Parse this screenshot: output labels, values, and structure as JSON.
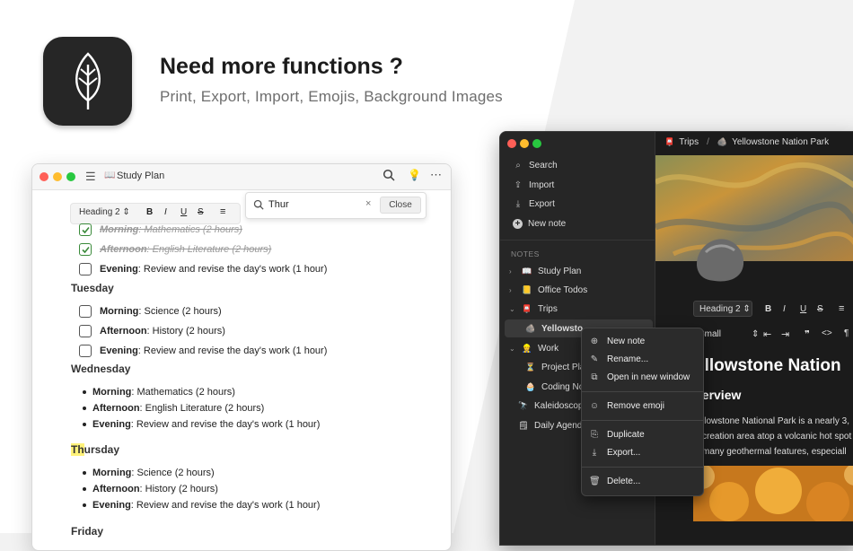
{
  "promo": {
    "headline": "Need more functions ?",
    "subline": "Print, Export, Import, Emojis, Background Images"
  },
  "light_window": {
    "title": "Study Plan",
    "format_bar": {
      "style": "Heading 2",
      "bold": "B",
      "italic": "I",
      "underline": "U",
      "strike": "S"
    },
    "search": {
      "value": "Thur",
      "close_label": "Close"
    },
    "tasks_top": [
      {
        "label": "Morning",
        "text": ": Mathematics (2 hours)",
        "done": true
      },
      {
        "label": "Afternoon",
        "text": ": English Literature (2 hours)",
        "done": true
      },
      {
        "label": "Evening",
        "text": ": Review and revise the day's work (1 hour)",
        "done": false
      }
    ],
    "tuesday": {
      "heading": "Tuesday",
      "tasks": [
        {
          "label": "Morning",
          "text": ": Science (2 hours)"
        },
        {
          "label": "Afternoon",
          "text": ": History (2 hours)"
        },
        {
          "label": "Evening",
          "text": ": Review and revise the day's work (1 hour)"
        }
      ]
    },
    "wednesday": {
      "heading": "Wednesday",
      "items": [
        {
          "label": "Morning",
          "text": ": Mathematics (2 hours)"
        },
        {
          "label": "Afternoon",
          "text": ": English Literature (2 hours)"
        },
        {
          "label": "Evening",
          "text": ": Review and revise the day's work (1 hour)"
        }
      ]
    },
    "thursday": {
      "heading_highlight": "Th",
      "heading_rest": "ursday",
      "items": [
        {
          "label": "Morning",
          "text": ": Science (2 hours)"
        },
        {
          "label": "Afternoon",
          "text": ": History (2 hours)"
        },
        {
          "label": "Evening",
          "text": ": Review and revise the day's work (1 hour)"
        }
      ]
    },
    "friday": {
      "heading": "Friday"
    }
  },
  "dark_window": {
    "breadcrumb": {
      "parent": "Trips",
      "separator": "/",
      "current": "Yellowstone Nation Park"
    },
    "sidebar": {
      "actions": [
        {
          "icon": "search-icon",
          "label": "Search"
        },
        {
          "icon": "import-icon",
          "label": "Import"
        },
        {
          "icon": "export-icon",
          "label": "Export"
        },
        {
          "icon": "plus-icon",
          "label": "New note"
        }
      ],
      "section_label": "NOTES",
      "notes": {
        "study_plan": "Study Plan",
        "office_todos": "Office Todos",
        "trips": "Trips",
        "yellowstone": "Yellowsto",
        "work": "Work",
        "project_plan": "Project Pla",
        "coding_notes": "Coding No",
        "kaleidoscope": "Kaleidoscop",
        "daily_agenda": "Daily Agend"
      }
    },
    "editor": {
      "format_style": "Heading 2",
      "size": "Small",
      "title": "ellowstone Nation",
      "subheading": "verview",
      "body_lines": [
        "llowstone National Park is a nearly 3,",
        "creation area atop a volcanic hot spot",
        "many geothermal features, especiall"
      ]
    },
    "context_menu": {
      "new_note": "New note",
      "rename": "Rename...",
      "open_window": "Open in new window",
      "remove_emoji": "Remove emoji",
      "duplicate": "Duplicate",
      "export": "Export...",
      "delete": "Delete..."
    }
  },
  "colors": {
    "background": "#f2f2f2",
    "slant": "#ffffff",
    "dark_bg": "#1e1e1e",
    "check_green": "#3a8a3a",
    "highlight": "#fff27a"
  }
}
